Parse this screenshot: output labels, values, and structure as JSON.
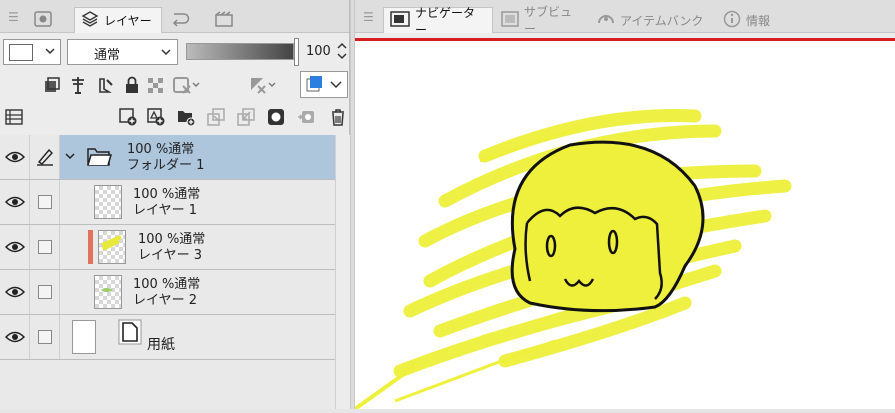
{
  "left_panel": {
    "tabs": [
      {
        "label": "",
        "icon": "layer-property-icon"
      },
      {
        "label": "レイヤー",
        "icon": "layers-icon",
        "active": true
      },
      {
        "label": "",
        "icon": "undo-history-icon"
      },
      {
        "label": "",
        "icon": "animation-icon"
      }
    ],
    "blend_mode": "通常",
    "opacity_value": "100",
    "opacity_fill": 1.0,
    "layers": [
      {
        "name_line1": "100 %通常",
        "name_line2": "フォルダー 1",
        "type": "folder",
        "selected": true
      },
      {
        "name_line1": "100 %通常",
        "name_line2": "レイヤー 1",
        "type": "layer"
      },
      {
        "name_line1": "100 %通常",
        "name_line2": "レイヤー 3",
        "type": "layer"
      },
      {
        "name_line1": "100 %通常",
        "name_line2": "レイヤー 2",
        "type": "layer"
      },
      {
        "name_line1": "",
        "name_line2": "用紙",
        "type": "paper"
      }
    ]
  },
  "right_panel": {
    "tabs": [
      {
        "label": "ナビゲーター",
        "icon": "navigator-icon",
        "active": true
      },
      {
        "label": "サブビュー",
        "icon": "subview-icon"
      },
      {
        "label": "アイテムバンク",
        "icon": "item-bank-icon"
      },
      {
        "label": "情報",
        "icon": "info-icon"
      }
    ]
  },
  "colors": {
    "selected_row": "#aec6dc",
    "navigator_border": "#d71e1e",
    "yellow_scribble": "#eef03b",
    "layer_color_tag": "#e2735b",
    "color_swatch": "#2c7fe0"
  }
}
